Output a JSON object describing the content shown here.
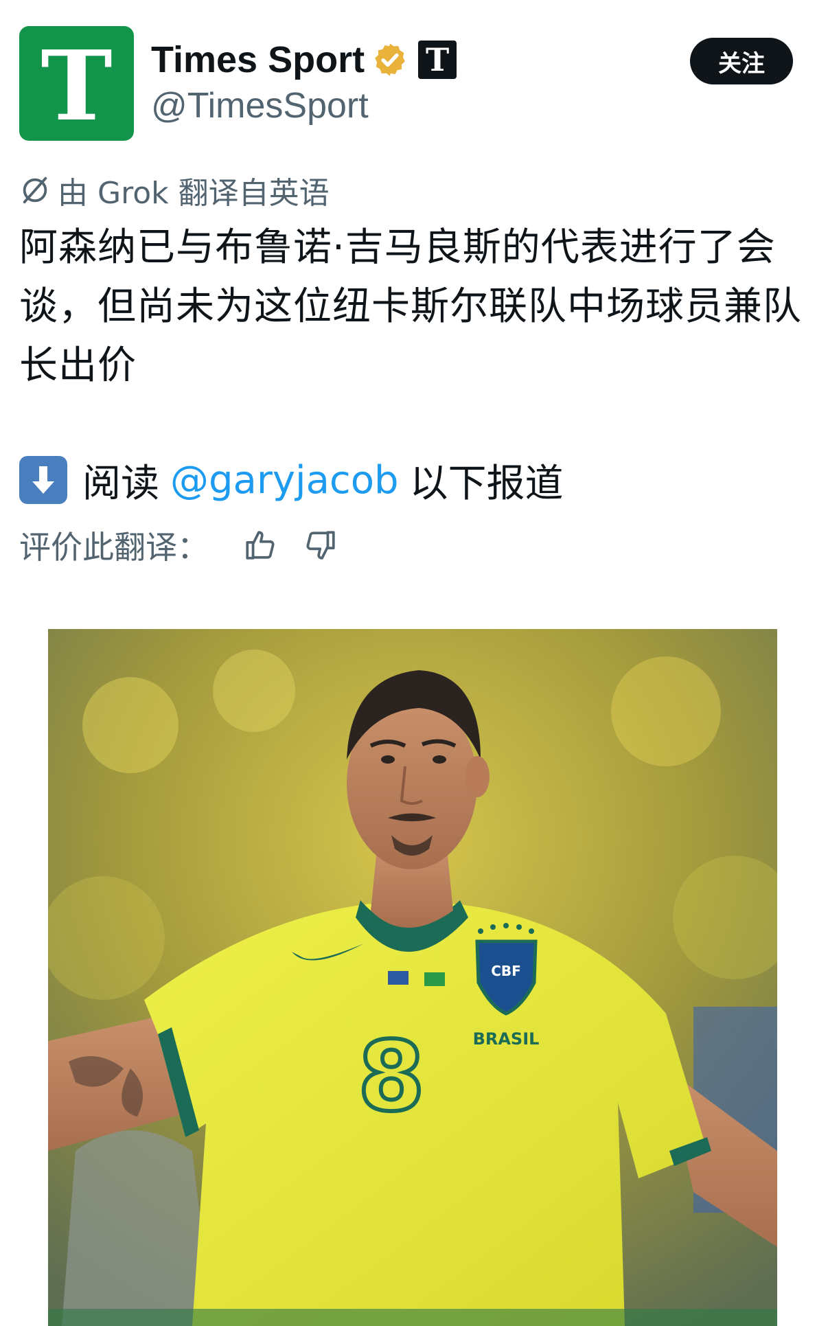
{
  "account": {
    "display_name": "Times Sport",
    "handle": "@TimesSport",
    "avatar_letter": "T",
    "badge_letter": "T",
    "avatar_color": "#12944a",
    "verified_color": "#e8b23b"
  },
  "follow_button": {
    "label": "关注"
  },
  "translation": {
    "note": "由 Grok 翻译自英语",
    "rate_label": "评价此翻译："
  },
  "tweet": {
    "text": "阿森纳已与布鲁诺·吉马良斯的代表进行了会谈，但尚未为这位纽卡斯尔联队中场球员兼队长出价",
    "read_prefix": "阅读",
    "mention": "@garyjacob",
    "read_suffix": "以下报道"
  },
  "photo": {
    "crest_text": "CBF",
    "country_text": "BRASIL",
    "shirt_number": "8",
    "shirt_color": "#e6e83a",
    "trim_color": "#1b6b57"
  },
  "colors": {
    "text_primary": "#0f1419",
    "text_secondary": "#536471",
    "link": "#1d9bf0"
  }
}
